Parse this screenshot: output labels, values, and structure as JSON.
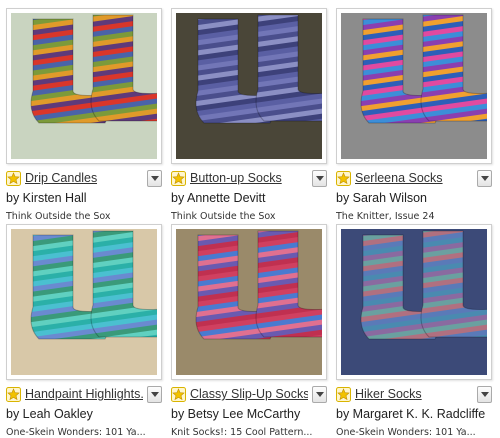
{
  "patterns": [
    {
      "title": "Drip Candles",
      "author": "by Kirsten Hall",
      "source": "Think Outside the Sox",
      "colors": [
        "#d9362a",
        "#4a63a8",
        "#7c9a3a",
        "#e09a2a",
        "#5e3a7a"
      ],
      "bg": "#c9d4c0"
    },
    {
      "title": "Button-up Socks",
      "author": "by Annette Devitt",
      "source": "Think Outside the Sox",
      "colors": [
        "#5a5fa3",
        "#7276b7",
        "#4a4e8c",
        "#8b8fc4",
        "#3d417a"
      ],
      "bg": "#4a4638"
    },
    {
      "title": "Serleena Socks",
      "author": "by Sarah Wilson",
      "source": "The Knitter, Issue 24",
      "colors": [
        "#2d5fb8",
        "#e04aa0",
        "#3c8ed8",
        "#8a3fb0",
        "#f0a030"
      ],
      "bg": "#8c8c8c"
    },
    {
      "title": "Handpaint Highlights...",
      "author": "by Leah Oakley",
      "source": "One-Skein Wonders: 101 Ya...",
      "colors": [
        "#2bb0a8",
        "#4ac0d0",
        "#6a8ad0",
        "#3a9a7a",
        "#60d0c0"
      ],
      "bg": "#d8c8a8"
    },
    {
      "title": "Classy Slip-Up Socks",
      "author": "by Betsy Lee McCarthy",
      "source": "Knit Socks!: 15 Cool Pattern...",
      "colors": [
        "#d04060",
        "#4a7ad0",
        "#e07090",
        "#6a5ab0",
        "#c03050"
      ],
      "bg": "#9a8a6a"
    },
    {
      "title": "Hiker Socks",
      "author": "by Margaret K. K. Radcliffe",
      "source": "One-Skein Wonders: 101 Ya...",
      "colors": [
        "#4a8ab0",
        "#8a6aa0",
        "#6aa0a0",
        "#b07080",
        "#5a7ab8"
      ],
      "bg": "#3c4a78"
    }
  ],
  "accent": "#f2c200"
}
